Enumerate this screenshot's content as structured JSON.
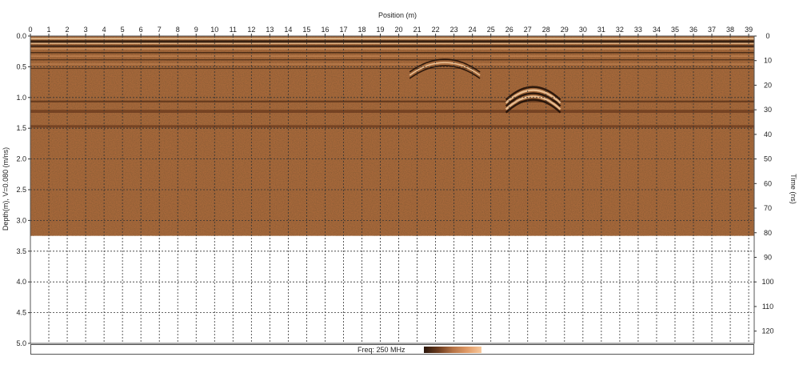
{
  "chart_data": {
    "type": "heatmap",
    "title": "",
    "xlabel": "Position (m)",
    "ylabel_left": "Depth(m), V=0.080 (m/ns)",
    "ylabel_right": "Time (ns)",
    "x_ticks": [
      "0",
      "1",
      "2",
      "3",
      "4",
      "5",
      "6",
      "7",
      "8",
      "9",
      "10",
      "11",
      "12",
      "13",
      "14",
      "15",
      "16",
      "17",
      "18",
      "19",
      "20",
      "21",
      "22",
      "23",
      "24",
      "25",
      "26",
      "27",
      "28",
      "29",
      "30",
      "31",
      "32",
      "33",
      "34",
      "35",
      "36",
      "37",
      "38",
      "39"
    ],
    "x_range": [
      0,
      39.3
    ],
    "depth_ticks": [
      "0.0",
      "0.5",
      "1.0",
      "1.5",
      "2.0",
      "2.5",
      "3.0",
      "3.5",
      "4.0",
      "4.5",
      "5.0"
    ],
    "depth_range": [
      0,
      5.0
    ],
    "time_ticks": [
      "0",
      "10",
      "20",
      "30",
      "40",
      "50",
      "60",
      "70",
      "80",
      "90",
      "100",
      "110",
      "120"
    ],
    "time_range": [
      0,
      125
    ],
    "data_extent_depth": 3.25,
    "grid": true,
    "colormap": [
      "#2a160c",
      "#6b3b1e",
      "#b57346",
      "#e09a66",
      "#f7c79a"
    ],
    "background_color": "#a7683a",
    "features": [
      {
        "type": "hyperbola",
        "position": 27.3,
        "depth": 0.75
      },
      {
        "type": "hyperbola",
        "position": 22.5,
        "depth": 0.3
      }
    ]
  },
  "footer": {
    "freq_label": "Freq: 250 MHz"
  }
}
